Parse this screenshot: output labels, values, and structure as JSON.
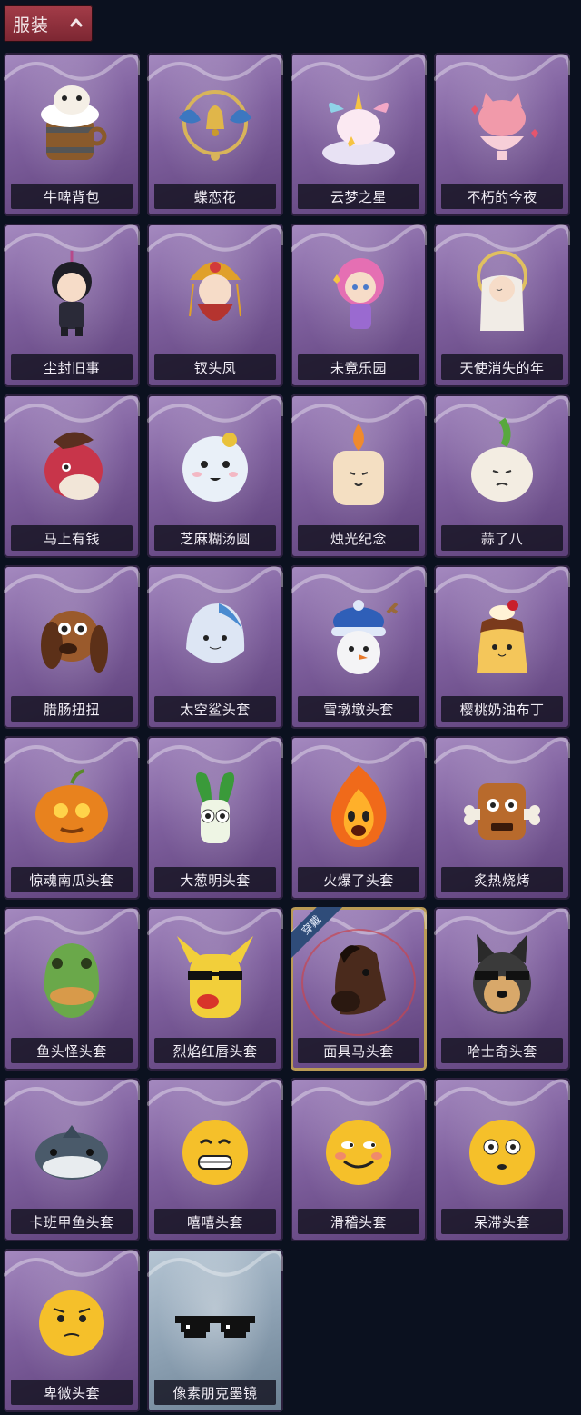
{
  "header": {
    "label": "服装"
  },
  "badge_text": "穿戴",
  "items": [
    {
      "name": "牛啤背包",
      "icon": "cow-beer-backpack"
    },
    {
      "name": "蝶恋花",
      "icon": "butterfly-bell-ornament"
    },
    {
      "name": "云梦之星",
      "icon": "unicorn-cloud"
    },
    {
      "name": "不朽的今夜",
      "icon": "pink-cat-cup"
    },
    {
      "name": "尘封旧事",
      "icon": "chibi-figure-dark"
    },
    {
      "name": "钗头凤",
      "icon": "phoenix-crown-chibi"
    },
    {
      "name": "未竟乐园",
      "icon": "pink-hair-chibi"
    },
    {
      "name": "天使消失的年",
      "icon": "angel-chibi"
    },
    {
      "name": "马上有钱",
      "icon": "red-horse-head"
    },
    {
      "name": "芝麻糊汤圆",
      "icon": "dumpling-head"
    },
    {
      "name": "烛光纪念",
      "icon": "candle-head"
    },
    {
      "name": "蒜了八",
      "icon": "garlic-head"
    },
    {
      "name": "腊肠扭扭",
      "icon": "dachshund-head"
    },
    {
      "name": "太空鲨头套",
      "icon": "space-shark-head"
    },
    {
      "name": "雪墩墩头套",
      "icon": "snowman-head"
    },
    {
      "name": "樱桃奶油布丁",
      "icon": "pudding-head"
    },
    {
      "name": "惊魂南瓜头套",
      "icon": "pumpkin-head"
    },
    {
      "name": "大葱明头套",
      "icon": "green-onion-head"
    },
    {
      "name": "火爆了头套",
      "icon": "fire-head"
    },
    {
      "name": "炙热烧烤",
      "icon": "bbq-meat-head"
    },
    {
      "name": "鱼头怪头套",
      "icon": "fish-mask-head"
    },
    {
      "name": "烈焰红唇头套",
      "icon": "pikachu-mask-head"
    },
    {
      "name": "面具马头套",
      "icon": "horse-mask-head",
      "selected": true
    },
    {
      "name": "哈士奇头套",
      "icon": "husky-head"
    },
    {
      "name": "卡班甲鱼头套",
      "icon": "fish-head"
    },
    {
      "name": "嘻嘻头套",
      "icon": "grin-emoji-head"
    },
    {
      "name": "滑稽头套",
      "icon": "smirk-emoji-head"
    },
    {
      "name": "呆滞头套",
      "icon": "dazed-emoji-head"
    },
    {
      "name": "卑微头套",
      "icon": "humble-emoji-head"
    },
    {
      "name": "像素朋克墨镜",
      "icon": "pixel-sunglasses",
      "rarity": "grey"
    }
  ]
}
